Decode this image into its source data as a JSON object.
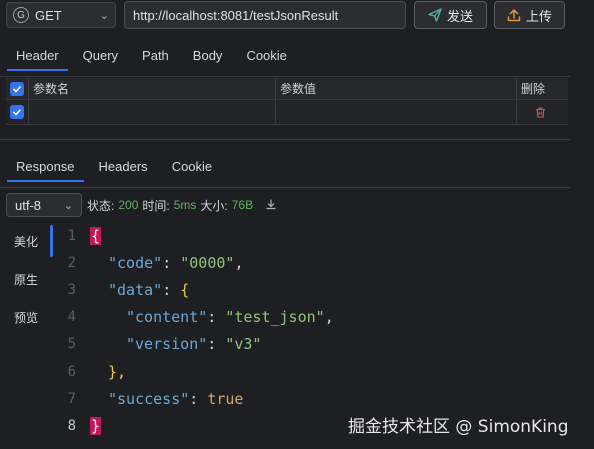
{
  "request": {
    "method": "GET",
    "method_badge": "G",
    "url": "http://localhost:8081/testJsonResult",
    "send_label": "发送",
    "upload_label": "上传"
  },
  "request_tabs": [
    "Header",
    "Query",
    "Path",
    "Body",
    "Cookie"
  ],
  "params_table": {
    "headers": {
      "name": "参数名",
      "value": "参数值",
      "delete": "删除"
    }
  },
  "response_tabs": [
    "Response",
    "Headers",
    "Cookie"
  ],
  "response_bar": {
    "encoding": "utf-8",
    "status_label": "状态:",
    "status_value": "200",
    "time_label": "时间:",
    "time_value": "5ms",
    "size_label": "大小:",
    "size_value": "76B"
  },
  "view_modes": [
    "美化",
    "原生",
    "预览"
  ],
  "response_body": {
    "line_numbers": [
      "1",
      "2",
      "3",
      "4",
      "5",
      "6",
      "7",
      "8"
    ],
    "tokens": {
      "open": "{",
      "close": "}",
      "code_key": "\"code\"",
      "code_val": "\"0000\"",
      "data_key": "\"data\"",
      "content_key": "\"content\"",
      "content_val": "\"test_json\"",
      "version_key": "\"version\"",
      "version_val": "\"v3\"",
      "inner_close": "},",
      "success_key": "\"success\"",
      "success_val": "true"
    }
  },
  "watermark": "掘金技术社区 @ SimonKing",
  "colors": {
    "accent": "#3574f0",
    "status_ok": "#5fb15f",
    "delete_icon": "#d9534f",
    "brace_highlight": "#c2185b"
  }
}
